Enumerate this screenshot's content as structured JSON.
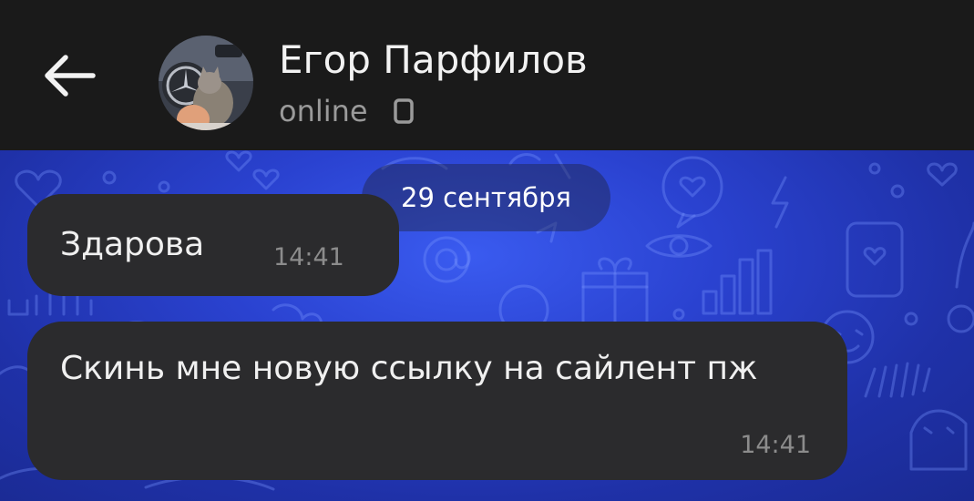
{
  "header": {
    "contact_name": "Егор Парфилов",
    "status": "online",
    "back_icon": "arrow-left-icon",
    "status_icon": "phone-icon",
    "background_color": "#1a1a1a"
  },
  "chat": {
    "date_separator": "29 сентября",
    "wallpaper_color": "#2a42d0",
    "messages": [
      {
        "text": "Здарова",
        "time": "14:41",
        "direction": "incoming"
      },
      {
        "text": "Скинь мне новую ссылку на сайлент пж",
        "time": "14:41",
        "direction": "incoming"
      }
    ],
    "bubble_color": "#2b2b2d"
  }
}
